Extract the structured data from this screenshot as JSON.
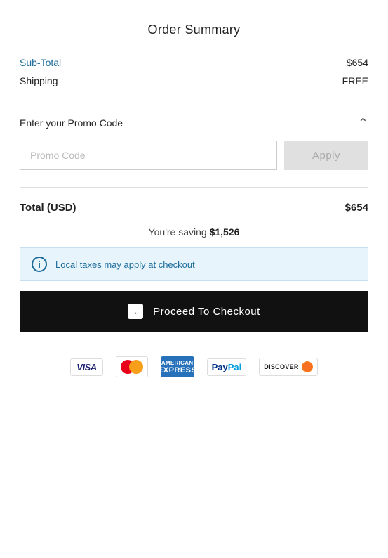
{
  "title": "Order Summary",
  "summary": {
    "subtotal_label": "Sub-Total",
    "subtotal_value": "$654",
    "shipping_label": "Shipping",
    "shipping_value": "FREE"
  },
  "promo": {
    "label": "Enter your Promo Code",
    "placeholder": "Promo Code",
    "apply_label": "Apply"
  },
  "total": {
    "label": "Total (USD)",
    "value": "$654"
  },
  "saving": {
    "prefix": "You're saving ",
    "amount": "$1,526"
  },
  "info_banner": {
    "text": "Local taxes may apply at checkout"
  },
  "checkout": {
    "label": "Proceed To Checkout"
  },
  "payment_methods": [
    "VISA",
    "Mastercard",
    "Amex",
    "PayPal",
    "Discover"
  ]
}
